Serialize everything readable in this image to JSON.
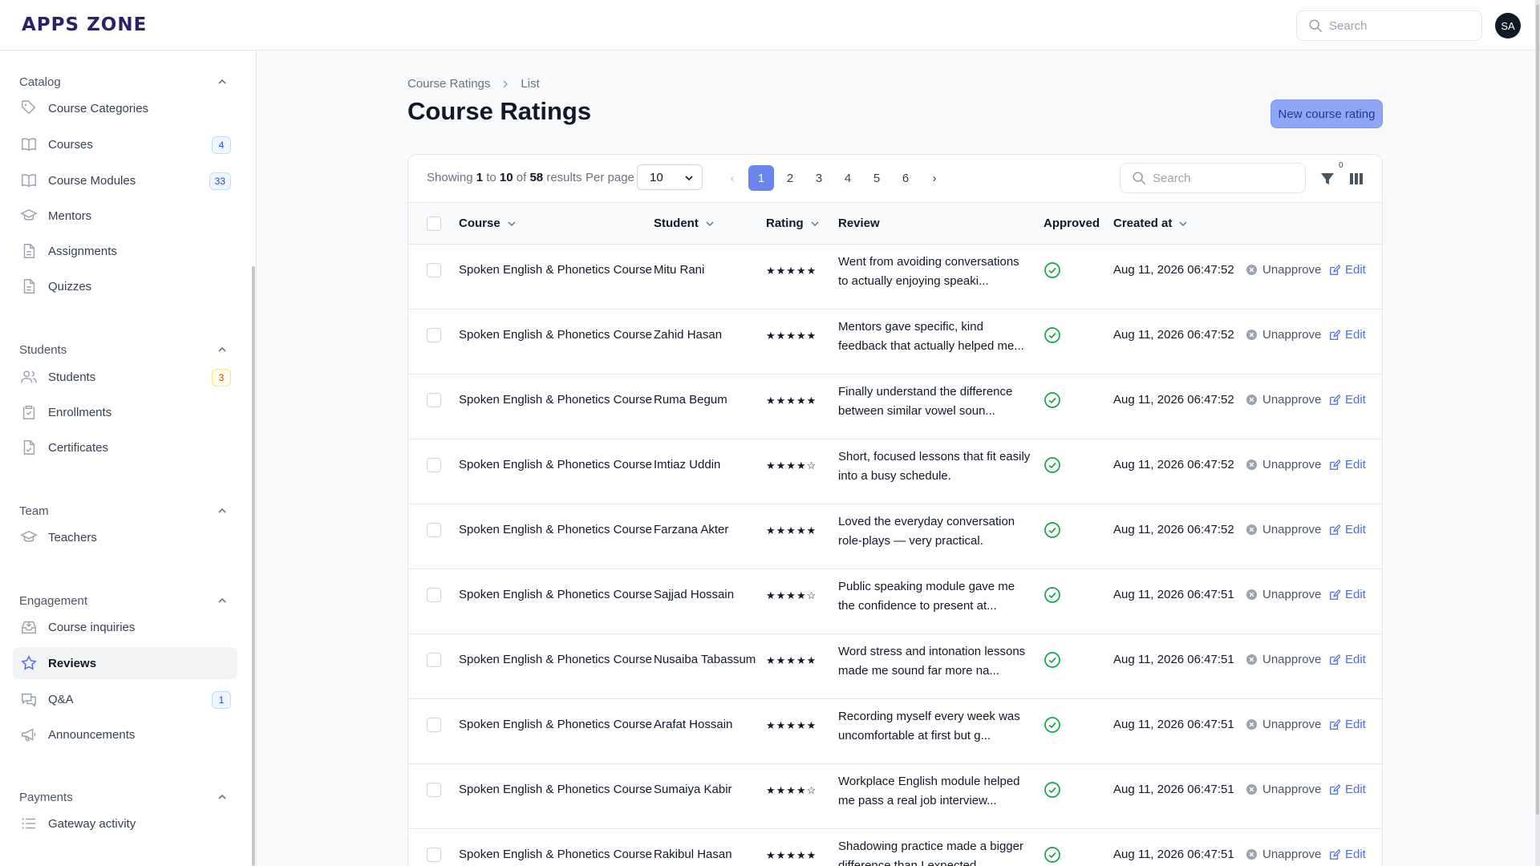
{
  "app": {
    "logo": "APPS ZONE",
    "avatar_initials": "SA",
    "search_placeholder": "Search"
  },
  "colors": {
    "accent": "#6b85f0",
    "approved": "#16a34a",
    "link": "#4f6bed",
    "logo": "#2e1f6b"
  },
  "sidebar": {
    "groups": [
      {
        "label": "Catalog",
        "items": [
          {
            "label": "Course Categories",
            "icon": "tag-icon"
          },
          {
            "label": "Courses",
            "icon": "book-icon",
            "badge": "4"
          },
          {
            "label": "Course Modules",
            "icon": "book-icon",
            "badge": "33"
          },
          {
            "label": "Mentors",
            "icon": "graduation-cap-icon"
          },
          {
            "label": "Assignments",
            "icon": "document-icon"
          },
          {
            "label": "Quizzes",
            "icon": "document-icon"
          }
        ]
      },
      {
        "label": "Students",
        "items": [
          {
            "label": "Students",
            "icon": "users-icon",
            "badge": "3"
          },
          {
            "label": "Enrollments",
            "icon": "clipboard-icon"
          },
          {
            "label": "Certificates",
            "icon": "document-check-icon"
          }
        ]
      },
      {
        "label": "Team",
        "items": [
          {
            "label": "Teachers",
            "icon": "graduation-cap-icon"
          }
        ]
      },
      {
        "label": "Engagement",
        "items": [
          {
            "label": "Course inquiries",
            "icon": "inbox-icon"
          },
          {
            "label": "Reviews",
            "icon": "star-icon",
            "active": true
          },
          {
            "label": "Q&A",
            "icon": "chat-bubbles-icon",
            "badge": "1"
          },
          {
            "label": "Announcements",
            "icon": "megaphone-icon"
          }
        ]
      },
      {
        "label": "Payments",
        "items": [
          {
            "label": "Gateway activity",
            "icon": "list-icon"
          }
        ]
      }
    ]
  },
  "breadcrumb": {
    "parent": "Course Ratings",
    "current": "List"
  },
  "page": {
    "title": "Course Ratings",
    "new_button": "New course rating"
  },
  "toolbar": {
    "showing_prefix": "Showing",
    "from": "1",
    "to_word": "to",
    "to": "10",
    "of_word": "of",
    "total": "58",
    "results_word": "results",
    "per_page_label": "Per page",
    "per_page_value": "10",
    "pages": [
      "1",
      "2",
      "3",
      "4",
      "5",
      "6"
    ],
    "current_page": "1",
    "prev": "‹",
    "next": "›",
    "search_placeholder": "Search",
    "filter_count": "0"
  },
  "table": {
    "columns": {
      "course": "Course",
      "student": "Student",
      "rating": "Rating",
      "review": "Review",
      "approved": "Approved",
      "created_at": "Created at"
    },
    "actions": {
      "unapprove": "Unapprove",
      "edit": "Edit"
    },
    "rows": [
      {
        "course": "Spoken English & Phonetics Course",
        "student": "Mitu Rani",
        "rating": 5,
        "review": "Went from avoiding conversations to actually enjoying speaki...",
        "created_at": "Aug 11, 2026 06:47:52"
      },
      {
        "course": "Spoken English & Phonetics Course",
        "student": "Zahid Hasan",
        "rating": 5,
        "review": "Mentors gave specific, kind feedback that actually helped me...",
        "created_at": "Aug 11, 2026 06:47:52"
      },
      {
        "course": "Spoken English & Phonetics Course",
        "student": "Ruma Begum",
        "rating": 5,
        "review": "Finally understand the difference between similar vowel soun...",
        "created_at": "Aug 11, 2026 06:47:52"
      },
      {
        "course": "Spoken English & Phonetics Course",
        "student": "Imtiaz Uddin",
        "rating": 4,
        "review": "Short, focused lessons that fit easily into a busy schedule.",
        "created_at": "Aug 11, 2026 06:47:52"
      },
      {
        "course": "Spoken English & Phonetics Course",
        "student": "Farzana Akter",
        "rating": 5,
        "review": "Loved the everyday conversation role-plays — very practical.",
        "created_at": "Aug 11, 2026 06:47:52"
      },
      {
        "course": "Spoken English & Phonetics Course",
        "student": "Sajjad Hossain",
        "rating": 4,
        "review": "Public speaking module gave me the confidence to present at...",
        "created_at": "Aug 11, 2026 06:47:51"
      },
      {
        "course": "Spoken English & Phonetics Course",
        "student": "Nusaiba Tabassum",
        "rating": 5,
        "review": "Word stress and intonation lessons made me sound far more na...",
        "created_at": "Aug 11, 2026 06:47:51"
      },
      {
        "course": "Spoken English & Phonetics Course",
        "student": "Arafat Hossain",
        "rating": 5,
        "review": "Recording myself every week was uncomfortable at first but g...",
        "created_at": "Aug 11, 2026 06:47:51"
      },
      {
        "course": "Spoken English & Phonetics Course",
        "student": "Sumaiya Kabir",
        "rating": 4,
        "review": "Workplace English module helped me pass a real job interview...",
        "created_at": "Aug 11, 2026 06:47:51"
      },
      {
        "course": "Spoken English & Phonetics Course",
        "student": "Rakibul Hasan",
        "rating": 5,
        "review": "Shadowing practice made a bigger difference than I expected...",
        "created_at": "Aug 11, 2026 06:47:51"
      }
    ]
  }
}
